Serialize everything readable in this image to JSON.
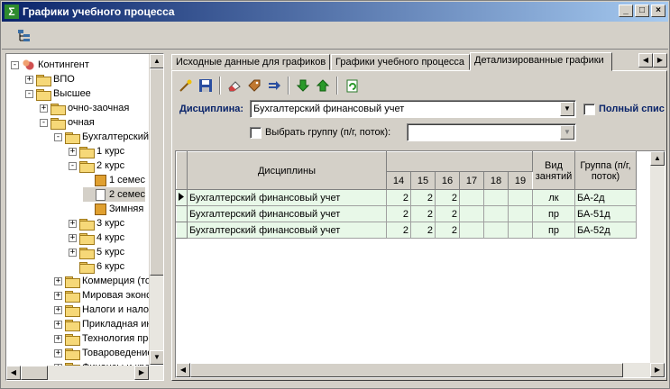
{
  "window": {
    "title": "Графики учебного процесса"
  },
  "tree": {
    "items": [
      {
        "label": "Контингент",
        "level": 0,
        "icon": "people-icon",
        "exp": "-"
      },
      {
        "label": "ВПО",
        "level": 1,
        "icon": "folder-icon",
        "exp": "+"
      },
      {
        "label": "Высшее",
        "level": 1,
        "icon": "folder-icon",
        "exp": "-"
      },
      {
        "label": "очно-заочная",
        "level": 2,
        "icon": "folder-icon",
        "exp": "+"
      },
      {
        "label": "очная",
        "level": 2,
        "icon": "folder-icon",
        "exp": "-"
      },
      {
        "label": "Бухгалтерский",
        "level": 3,
        "icon": "folder-icon",
        "exp": "-"
      },
      {
        "label": "1 курс",
        "level": 4,
        "icon": "folder-icon",
        "exp": "+"
      },
      {
        "label": "2 курс",
        "level": 4,
        "icon": "folder-icon",
        "exp": "-"
      },
      {
        "label": "1 семес",
        "level": 5,
        "icon": "box-icon",
        "exp": ""
      },
      {
        "label": "2 семес",
        "level": 5,
        "icon": "document-icon",
        "exp": "",
        "selected": true
      },
      {
        "label": "Зимняя",
        "level": 5,
        "icon": "box-icon",
        "exp": ""
      },
      {
        "label": "3 курс",
        "level": 4,
        "icon": "folder-icon",
        "exp": "+"
      },
      {
        "label": "4 курс",
        "level": 4,
        "icon": "folder-icon",
        "exp": "+"
      },
      {
        "label": "5 курс",
        "level": 4,
        "icon": "folder-icon",
        "exp": "+"
      },
      {
        "label": "6 курс",
        "level": 4,
        "icon": "folder-icon",
        "exp": ""
      },
      {
        "label": "Коммерция (тор",
        "level": 3,
        "icon": "folder-icon",
        "exp": "+"
      },
      {
        "label": "Мировая эконо",
        "level": 3,
        "icon": "folder-icon",
        "exp": "+"
      },
      {
        "label": "Налоги и налог",
        "level": 3,
        "icon": "folder-icon",
        "exp": "+"
      },
      {
        "label": "Прикладная ин",
        "level": 3,
        "icon": "folder-icon",
        "exp": "+"
      },
      {
        "label": "Технология пре",
        "level": 3,
        "icon": "folder-icon",
        "exp": "+"
      },
      {
        "label": "Товароведение",
        "level": 3,
        "icon": "folder-icon",
        "exp": "+"
      },
      {
        "label": "Финансы и кре",
        "level": 3,
        "icon": "folder-icon",
        "exp": "+"
      }
    ]
  },
  "tabs": [
    {
      "label": "Исходные данные для графиков"
    },
    {
      "label": "Графики учебного процесса"
    },
    {
      "label": "Детализированные графики",
      "active": true
    }
  ],
  "form": {
    "discipline_label": "Дисциплина:",
    "discipline_value": "Бухгалтерский финансовый учет",
    "full_list_label": "Полный спис",
    "select_group_label": "Выбрать группу (п/г, поток):",
    "select_group_value": ""
  },
  "grid": {
    "header_discipline": "Дисциплины",
    "week_cols": [
      "14",
      "15",
      "16",
      "17",
      "18",
      "19"
    ],
    "header_type": "Вид занятий",
    "header_group": "Группа (п/г, поток)",
    "rows": [
      {
        "discipline": "Бухгалтерский финансовый учет",
        "w14": "2",
        "w15": "2",
        "w16": "2",
        "w17": "",
        "w18": "",
        "w19": "",
        "type": "лк",
        "group": "БА-2д"
      },
      {
        "discipline": "Бухгалтерский финансовый учет",
        "w14": "2",
        "w15": "2",
        "w16": "2",
        "w17": "",
        "w18": "",
        "w19": "",
        "type": "пр",
        "group": "БА-51д"
      },
      {
        "discipline": "Бухгалтерский финансовый учет",
        "w14": "2",
        "w15": "2",
        "w16": "2",
        "w17": "",
        "w18": "",
        "w19": "",
        "type": "пр",
        "group": "БА-52д"
      }
    ]
  },
  "colors": {
    "title_start": "#0a246a",
    "title_end": "#a6caf0",
    "row_bg": "#e8f8e8",
    "label_blue": "#0a246a"
  }
}
